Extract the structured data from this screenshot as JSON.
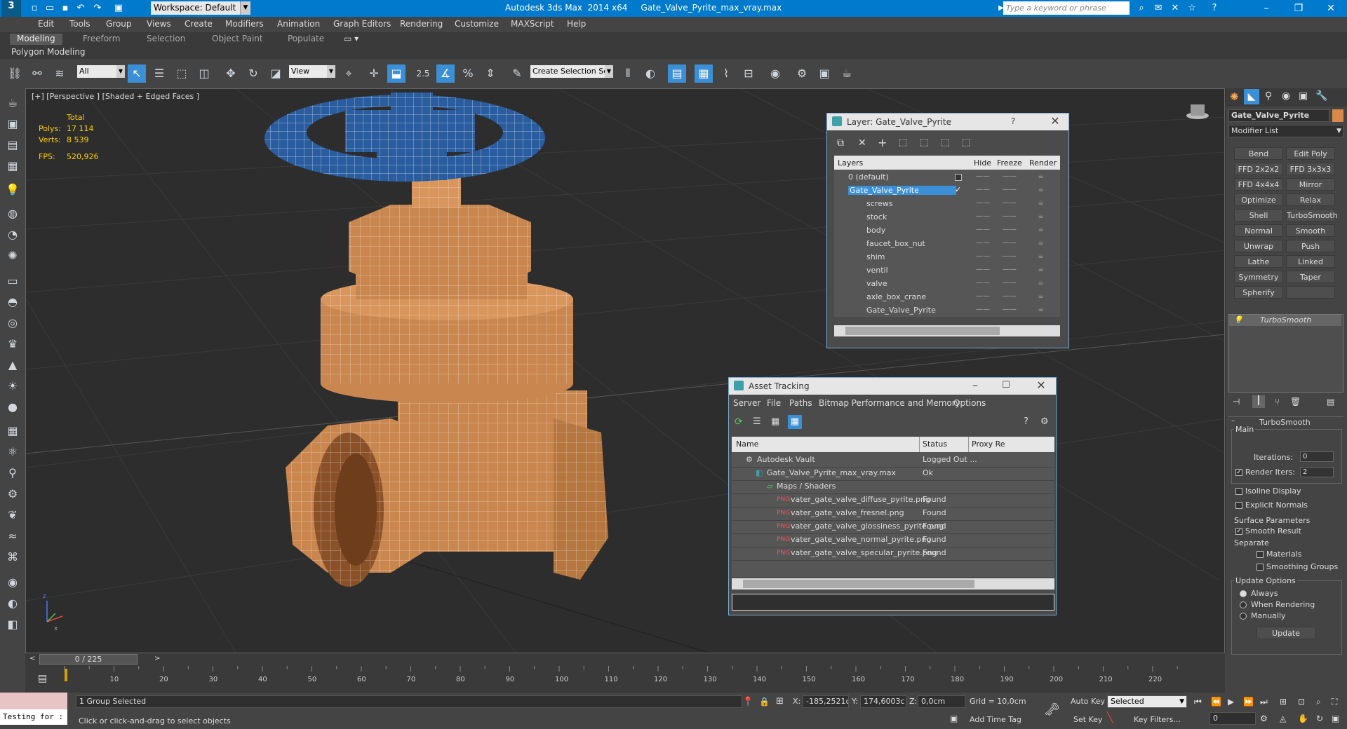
{
  "app": {
    "title": "Autodesk 3ds Max  2014 x64     Gate_Valve_Pyrite_max_vray.max",
    "workspace": "Workspace: Default",
    "search_placeholder": "Type a keyword or phrase"
  },
  "menu": [
    "Edit",
    "Tools",
    "Group",
    "Views",
    "Create",
    "Modifiers",
    "Animation",
    "Graph Editors",
    "Rendering",
    "Customize",
    "MAXScript",
    "Help"
  ],
  "ribbon": {
    "tabs": [
      "Modeling",
      "Freeform",
      "Selection",
      "Object Paint",
      "Populate"
    ],
    "active": "Modeling",
    "subpanel": "Polygon Modeling"
  },
  "toolbar": {
    "filter": "All",
    "ref_coord": "View",
    "snap_angle": "2.5",
    "selection_set": "Create Selection Se"
  },
  "viewport": {
    "label": "[+] [Perspective ] [Shaded + Edged Faces ]",
    "stats": {
      "total_label": "Total",
      "polys_label": "Polys:",
      "polys": "17 114",
      "verts_label": "Verts:",
      "verts": "8 539",
      "fps_label": "FPS:",
      "fps": "520,926"
    }
  },
  "layer_dialog": {
    "title": "Layer: Gate_Valve_Pyrite",
    "help": "?",
    "columns": [
      "Layers",
      "Hide",
      "Freeze",
      "Render"
    ],
    "rows": [
      {
        "name": "0 (default)",
        "indent": 0
      },
      {
        "name": "Gate_Valve_Pyrite",
        "indent": 0,
        "selected": true
      },
      {
        "name": "screws",
        "indent": 1
      },
      {
        "name": "stock",
        "indent": 1
      },
      {
        "name": "body",
        "indent": 1
      },
      {
        "name": "faucet_box_nut",
        "indent": 1
      },
      {
        "name": "shim",
        "indent": 1
      },
      {
        "name": "ventil",
        "indent": 1
      },
      {
        "name": "valve",
        "indent": 1
      },
      {
        "name": "axle_box_crane",
        "indent": 1
      },
      {
        "name": "Gate_Valve_Pyrite",
        "indent": 1
      }
    ]
  },
  "asset_dialog": {
    "title": "Asset Tracking",
    "menu": [
      "Server",
      "File",
      "Paths",
      "Bitmap Performance and Memory",
      "Options"
    ],
    "columns": [
      "Name",
      "Status",
      "Proxy Re"
    ],
    "rows": [
      {
        "name": "Autodesk Vault",
        "status": "Logged Out ...",
        "indent": 1
      },
      {
        "name": "Gate_Valve_Pyrite_max_vray.max",
        "status": "Ok",
        "indent": 2
      },
      {
        "name": "Maps / Shaders",
        "status": "",
        "indent": 3
      },
      {
        "name": "vater_gate_valve_diffuse_pyrite.png",
        "status": "Found",
        "indent": 4
      },
      {
        "name": "vater_gate_valve_fresnel.png",
        "status": "Found",
        "indent": 4
      },
      {
        "name": "vater_gate_valve_glossiness_pyrite.png",
        "status": "Found",
        "indent": 4
      },
      {
        "name": "vater_gate_valve_normal_pyrite.png",
        "status": "Found",
        "indent": 4
      },
      {
        "name": "vater_gate_valve_specular_pyrite.png",
        "status": "Found",
        "indent": 4
      }
    ]
  },
  "command_panel": {
    "object_name": "Gate_Valve_Pyrite",
    "modifier_list": "Modifier List",
    "modifier_buttons": [
      "Bend",
      "Edit Poly",
      "FFD 2x2x2",
      "FFD 3x3x3",
      "FFD 4x4x4",
      "Mirror",
      "Optimize",
      "Relax",
      "Shell",
      "TurboSmooth",
      "Normal",
      "Smooth",
      "Unwrap UVW",
      "Push",
      "Lathe",
      "Linked XForm",
      "Symmetry",
      "Taper",
      "Spherify"
    ],
    "stack_item": "TurboSmooth",
    "rollout_title": "TurboSmooth",
    "main_label": "Main",
    "iterations_label": "Iterations:",
    "iterations": "0",
    "render_iters_label": "Render Iters:",
    "render_iters": "2",
    "isoline": "Isoline Display",
    "explicit_normals": "Explicit Normals",
    "surface_params": "Surface Parameters",
    "smooth_result": "Smooth Result",
    "separate": "Separate",
    "materials": "Materials",
    "smoothing_groups": "Smoothing Groups",
    "update_options": "Update Options",
    "always": "Always",
    "when_rendering": "When Rendering",
    "manually": "Manually",
    "update": "Update"
  },
  "timeline": {
    "frame": "0 / 225",
    "ticks": [
      "10",
      "20",
      "30",
      "40",
      "50",
      "60",
      "70",
      "80",
      "90",
      "100",
      "110",
      "120",
      "130",
      "140",
      "150",
      "160",
      "170",
      "180",
      "190",
      "200",
      "210",
      "220"
    ]
  },
  "status": {
    "maxscript": "Testing for :",
    "selected": "1 Group Selected",
    "prompt": "Click or click-and-drag to select objects",
    "x_label": "X:",
    "x": "-185,2521c",
    "y_label": "Y:",
    "y": "174,6003c",
    "z_label": "Z:",
    "z": "0,0cm",
    "grid": "Grid = 10,0cm",
    "add_time_tag": "Add Time Tag",
    "auto_key": "Auto Key",
    "set_key": "Set Key",
    "selected_dd": "Selected",
    "key_filters": "Key Filters...",
    "frame_field": "0"
  },
  "colors": {
    "titlebar": "#007acc",
    "handle": "#2a5d9f",
    "body": "#c9874f",
    "selection": "#3b8fd6"
  }
}
